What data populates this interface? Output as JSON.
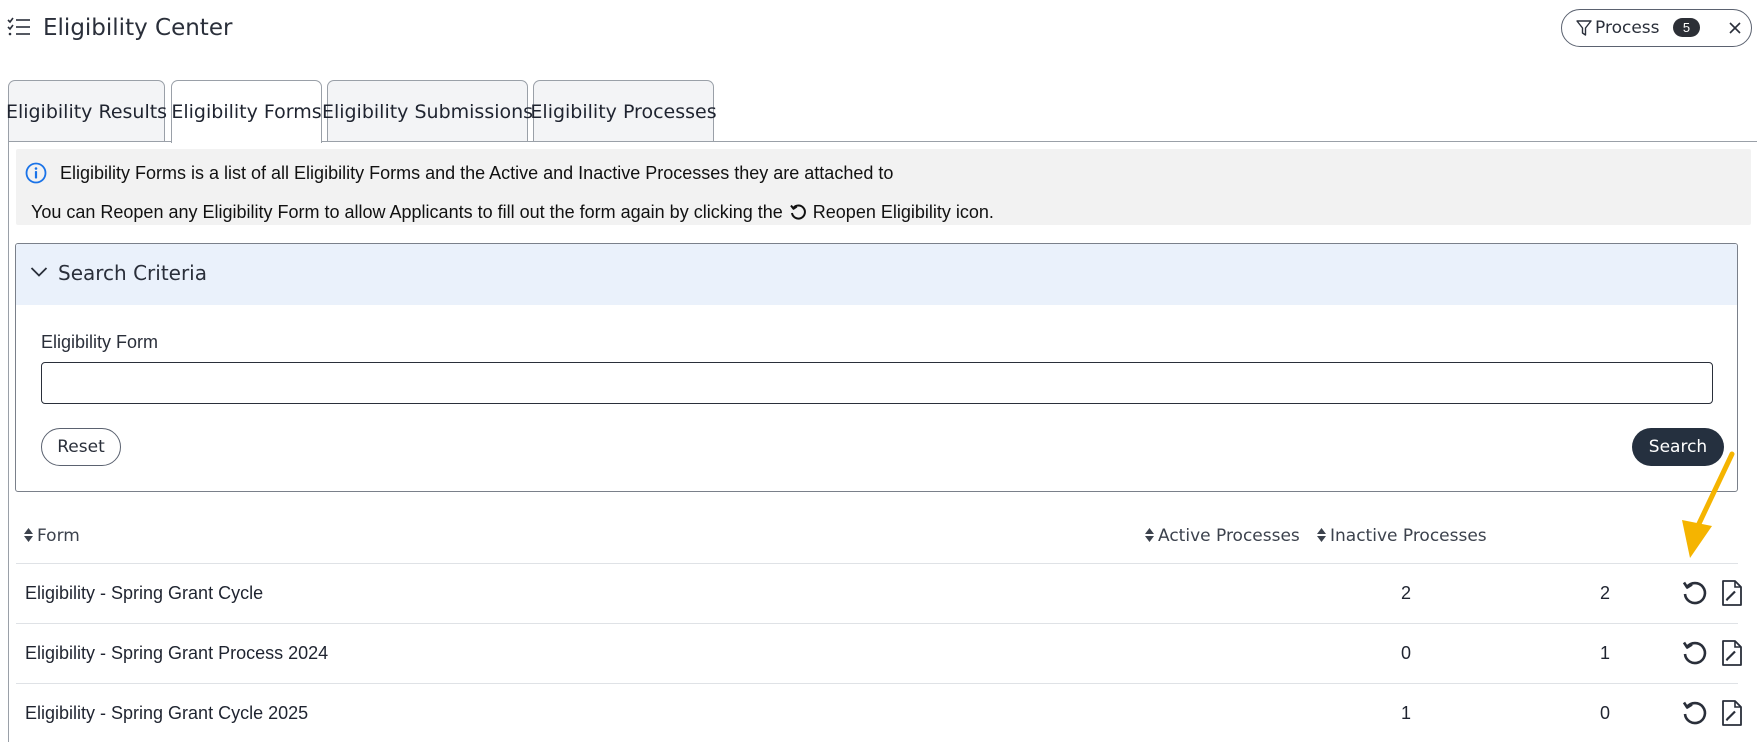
{
  "header": {
    "title": "Eligibility Center",
    "menu_icon": "list-check-icon",
    "filter_chip": {
      "label": "Process",
      "count": "5"
    }
  },
  "tabs": [
    {
      "label": "Eligibility Results",
      "active": false
    },
    {
      "label": "Eligibility Forms",
      "active": true
    },
    {
      "label": "Eligibility Submissions",
      "active": false
    },
    {
      "label": "Eligibility Processes",
      "active": false
    }
  ],
  "info": {
    "line1": "Eligibility Forms is a list of all Eligibility Forms and the Active and Inactive Processes they are attached to",
    "line2_before": "You can Reopen any Eligibility Form to allow Applicants to fill out the form again by clicking the",
    "line2_after": "Reopen Eligibility icon."
  },
  "search": {
    "title": "Search Criteria",
    "field_label": "Eligibility Form",
    "field_value": "",
    "reset_label": "Reset",
    "search_label": "Search"
  },
  "table": {
    "columns": {
      "form": "Form",
      "active": "Active Processes",
      "inactive": "Inactive Processes"
    },
    "rows": [
      {
        "form": "Eligibility - Spring Grant Cycle",
        "active": "2",
        "inactive": "2"
      },
      {
        "form": "Eligibility - Spring Grant Process 2024",
        "active": "0",
        "inactive": "1"
      },
      {
        "form": "Eligibility - Spring Grant Cycle 2025",
        "active": "1",
        "inactive": "0"
      }
    ]
  },
  "colors": {
    "accent_dark": "#25303f",
    "info_blue": "#1a73e8",
    "annotation_arrow": "#f5b400",
    "search_header_bg": "#eaf1fb"
  }
}
